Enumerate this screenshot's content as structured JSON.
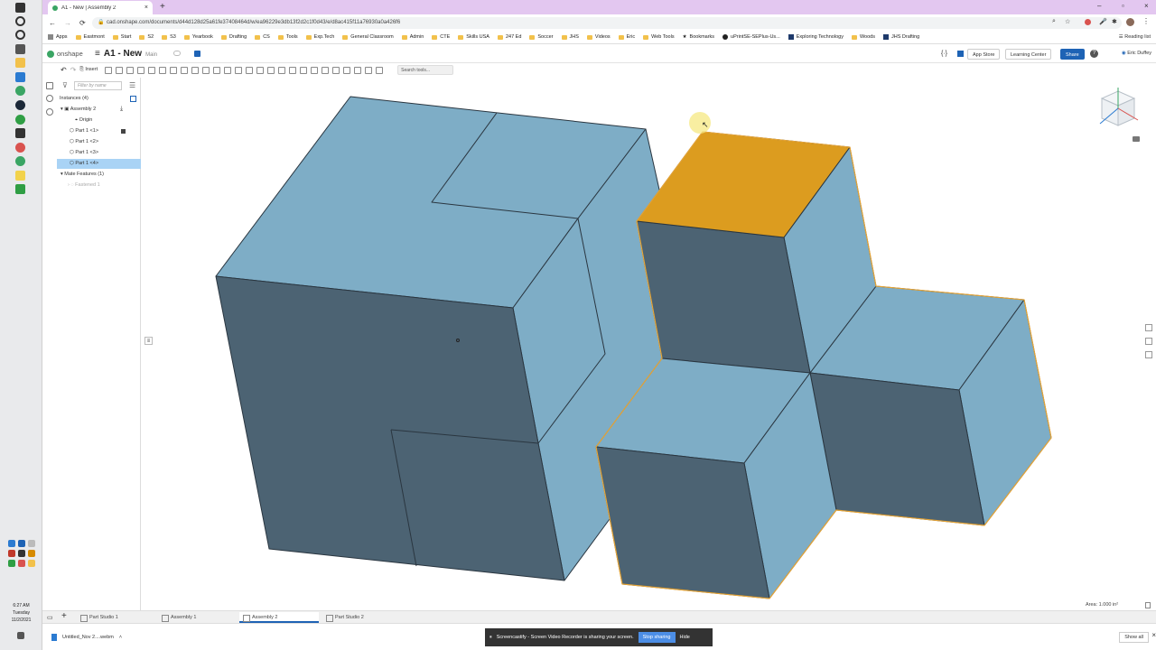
{
  "browser": {
    "tab_title": "A1 - New | Assembly 2",
    "url": "cad.onshape.com/documents/d44d128d25a61fe37408464d/w/ea96229e3db13f2d2c1f0d43/e/d8ac415f11a76930a0a426f6",
    "bookmarks": [
      "Apps",
      "Eastmont",
      "Start",
      "S2",
      "S3",
      "Yearbook",
      "Drafting",
      "CS",
      "Tools",
      "Exp.Tech",
      "General Classroom",
      "Admin",
      "CTE",
      "Skills USA",
      "247 Ed",
      "Soccer",
      "JHS",
      "Videos",
      "Eric",
      "Web Tools",
      "Bookmarks",
      "uPrintSE-SEPlus-Us...",
      "Exploring Technology",
      "Woods",
      "JHS Drafting"
    ],
    "reading_list": "Reading list"
  },
  "onshape": {
    "logo": "onshape",
    "doc_name": "A1 - New",
    "branch": "Main",
    "app_store": "App Store",
    "learning_center": "Learning Center",
    "share": "Share",
    "user": "Eric Duffey"
  },
  "toolbar": {
    "insert": "Insert",
    "search": "Search tools..."
  },
  "panel": {
    "filter_placeholder": "Filter by name",
    "instances": "Instances (4)",
    "assembly": "Assembly 2",
    "origin": "Origin",
    "parts": [
      "Part 1 <1>",
      "Part 1 <2>",
      "Part 1 <3>",
      "Part 1 <4>"
    ],
    "mate_features": "Mate Features (1)",
    "fastened": "Fastened 1"
  },
  "viewport": {
    "area_readout": "Area: 1.000 in²"
  },
  "bottom_tabs": [
    "Part Studio 1",
    "Assembly 1",
    "Assembly 2",
    "Part Studio 2"
  ],
  "downloads": {
    "file": "Untitled_Nov 2....webm",
    "sharing_msg": "Screencastify - Screen Video Recorder is sharing your screen.",
    "stop_sharing": "Stop sharing",
    "hide": "Hide",
    "show_all": "Show all"
  },
  "clock": {
    "time": "6:27 AM",
    "day": "Tuesday",
    "date": "11/2/2021"
  },
  "colors": {
    "face_light": "#7eadc6",
    "face_dark": "#4c6373",
    "highlight": "#dc9c1f",
    "accent": "#1e63b5"
  }
}
